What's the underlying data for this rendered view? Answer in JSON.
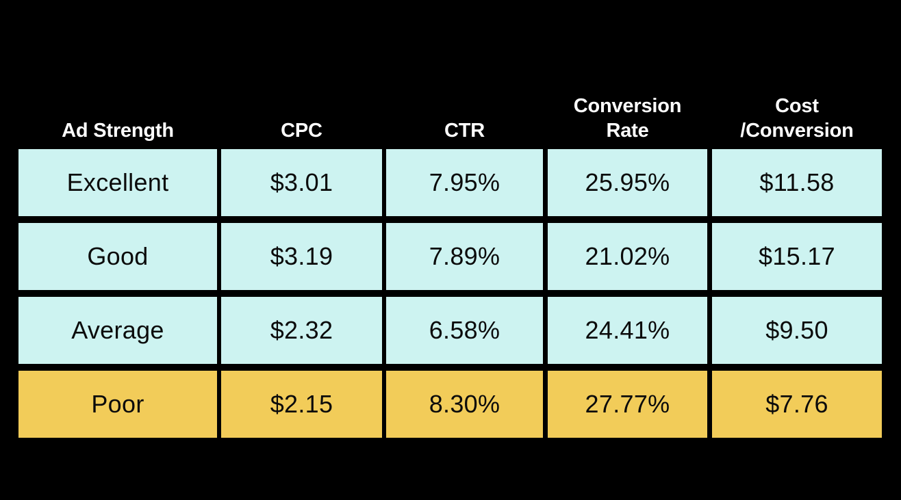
{
  "colors": {
    "background": "#000000",
    "cell_default": "#cdf3f1",
    "cell_highlight": "#f2cc59",
    "header_text": "#ffffff",
    "cell_text": "#0b0b0b"
  },
  "table": {
    "columns": [
      {
        "id": "ad-strength",
        "label": "Ad Strength",
        "label_lines": [
          "Ad Strength"
        ]
      },
      {
        "id": "cpc",
        "label": "CPC",
        "label_lines": [
          "CPC"
        ]
      },
      {
        "id": "ctr",
        "label": "CTR",
        "label_lines": [
          "CTR"
        ]
      },
      {
        "id": "conversion-rate",
        "label": "Conversion Rate",
        "label_lines": [
          "Conversion",
          "Rate"
        ]
      },
      {
        "id": "cost-per-conversion",
        "label": "Cost /Conversion",
        "label_lines": [
          "Cost",
          "/Conversion"
        ]
      }
    ],
    "rows": [
      {
        "id": "excellent",
        "highlight": false,
        "cells": [
          "Excellent",
          "$3.01",
          "7.95%",
          "25.95%",
          "$11.58"
        ]
      },
      {
        "id": "good",
        "highlight": false,
        "cells": [
          "Good",
          "$3.19",
          "7.89%",
          "21.02%",
          "$15.17"
        ]
      },
      {
        "id": "average",
        "highlight": false,
        "cells": [
          "Average",
          "$2.32",
          "6.58%",
          "24.41%",
          "$9.50"
        ]
      },
      {
        "id": "poor",
        "highlight": true,
        "cells": [
          "Poor",
          "$2.15",
          "8.30%",
          "27.77%",
          "$7.76"
        ]
      }
    ]
  },
  "chart_data": {
    "type": "table",
    "title": "",
    "columns": [
      "Ad Strength",
      "CPC",
      "CTR",
      "Conversion Rate",
      "Cost /Conversion"
    ],
    "rows": [
      [
        "Excellent",
        "$3.01",
        "7.95%",
        "25.95%",
        "$11.58"
      ],
      [
        "Good",
        "$3.19",
        "7.89%",
        "21.02%",
        "$15.17"
      ],
      [
        "Average",
        "$2.32",
        "6.58%",
        "24.41%",
        "$9.50"
      ],
      [
        "Poor",
        "$2.15",
        "8.30%",
        "27.77%",
        "$7.76"
      ]
    ],
    "highlighted_rows": [
      "Poor"
    ],
    "series": [
      {
        "name": "CPC",
        "categories": [
          "Excellent",
          "Good",
          "Average",
          "Poor"
        ],
        "values": [
          3.01,
          3.19,
          2.32,
          2.15
        ]
      },
      {
        "name": "CTR",
        "categories": [
          "Excellent",
          "Good",
          "Average",
          "Poor"
        ],
        "values": [
          7.95,
          7.89,
          6.58,
          8.3
        ]
      },
      {
        "name": "Conversion Rate",
        "categories": [
          "Excellent",
          "Good",
          "Average",
          "Poor"
        ],
        "values": [
          25.95,
          21.02,
          24.41,
          27.77
        ]
      },
      {
        "name": "Cost /Conversion",
        "categories": [
          "Excellent",
          "Good",
          "Average",
          "Poor"
        ],
        "values": [
          11.58,
          15.17,
          9.5,
          7.76
        ]
      }
    ],
    "legend": [],
    "grid": false
  }
}
